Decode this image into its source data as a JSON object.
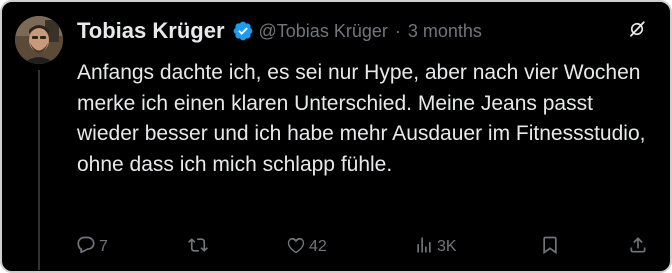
{
  "tweet": {
    "author_name": "Tobias Krüger",
    "handle": "@Tobias Krüger",
    "separator": "·",
    "time_ago": "3 months",
    "text": "Anfangs dachte ich, es sei nur Hype, aber nach vier Wochen merke ich einen klaren Unterschied. Meine Jeans passt wieder besser und ich habe mehr Ausdauer im Fitnessstudio, ohne dass ich mich schlapp fühle.",
    "verified_color": "#1d9bf0",
    "icons": {
      "verified": "verified-badge-icon",
      "grok": "grok-icon",
      "reply": "reply-icon",
      "retweet": "retweet-icon",
      "like": "like-icon",
      "views": "views-icon",
      "bookmark": "bookmark-icon",
      "share": "share-icon"
    }
  },
  "actions": {
    "reply_count": "7",
    "like_count": "42",
    "view_count": "3K"
  }
}
